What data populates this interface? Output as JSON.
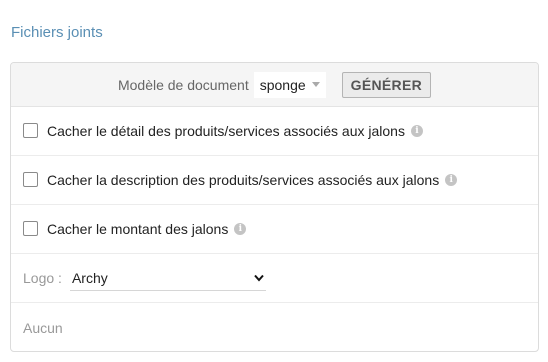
{
  "section": {
    "title": "Fichiers joints"
  },
  "model": {
    "label": "Modèle de document",
    "value": "sponge",
    "generate_label": "GÉNÉRER"
  },
  "options": [
    {
      "label": "Cacher le détail des produits/services associés aux jalons",
      "checked": false,
      "info_icon": "info-icon"
    },
    {
      "label": "Cacher la description des produits/services associés aux jalons",
      "checked": false,
      "info_icon": "info-icon"
    },
    {
      "label": "Cacher le montant des jalons",
      "checked": false,
      "info_icon": "info-icon"
    }
  ],
  "logo": {
    "label": "Logo :",
    "value": "Archy"
  },
  "attachments": {
    "empty_text": "Aucun"
  },
  "colors": {
    "title": "#5a8fb4",
    "header_bg": "#f5f5f5",
    "border": "#dcdcdc"
  }
}
